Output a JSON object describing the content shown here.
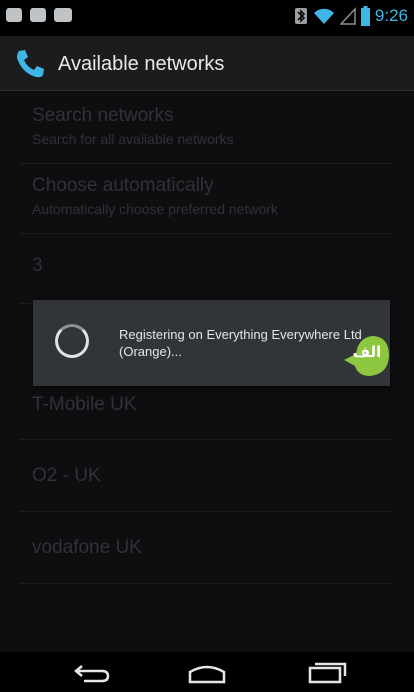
{
  "status_bar": {
    "time": "9:26",
    "left_icons": [
      "chat-notification-icon",
      "gallery-notification-icon",
      "voicemail-notification-icon"
    ],
    "right_icons": [
      "bluetooth-icon",
      "wifi-icon",
      "signal-icon",
      "battery-icon"
    ]
  },
  "action_bar": {
    "icon": "phone-icon",
    "title": "Available networks"
  },
  "list": {
    "items": [
      {
        "title": "Search networks",
        "subtitle": "Search for all available networks"
      },
      {
        "title": "Choose automatically",
        "subtitle": "Automatically choose preferred network"
      },
      {
        "title": "3",
        "subtitle": ""
      },
      {
        "title": "T-Mobile UK",
        "subtitle": ""
      },
      {
        "title": "O2 - UK",
        "subtitle": ""
      },
      {
        "title": "vodafone UK",
        "subtitle": ""
      }
    ]
  },
  "dialog": {
    "message": "Registering on Everything Everywhere Ltd (Orange)..."
  },
  "watermark": {
    "text": "الف"
  },
  "nav_bar": {
    "buttons": [
      "back-icon",
      "home-icon",
      "recent-apps-icon"
    ]
  },
  "colors": {
    "accent": "#3fb6e8",
    "dialog_bg": "#323537",
    "watermark_green": "#8dc63f"
  }
}
